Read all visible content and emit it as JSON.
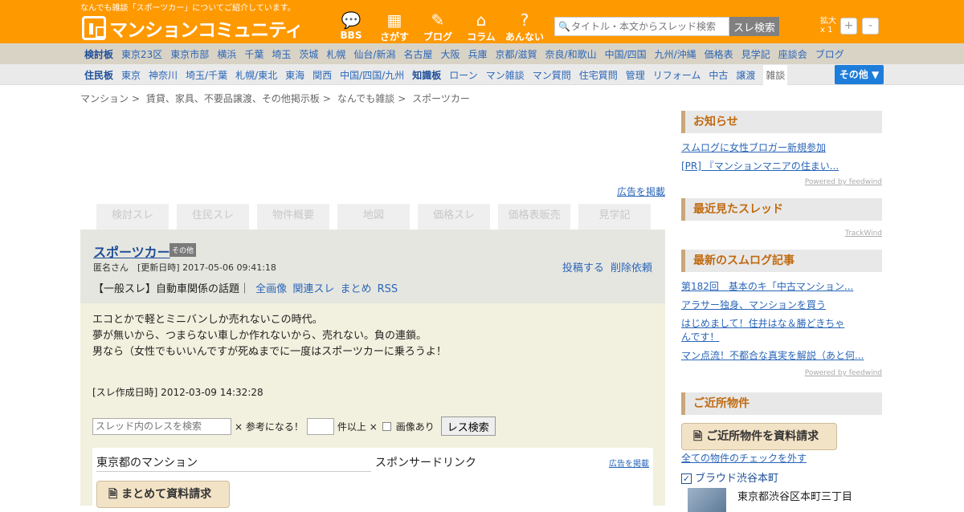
{
  "header": {
    "tagline": "なんでも雑談「スポーツカー」についてご紹介しています。",
    "logo_text": "マンションコミュニティ",
    "nav": [
      {
        "label": "BBS",
        "icon": "speech-bubble-icon"
      },
      {
        "label": "さがす",
        "icon": "buildings-icon"
      },
      {
        "label": "ブログ",
        "icon": "pen-icon"
      },
      {
        "label": "コラム",
        "icon": "house-icon"
      },
      {
        "label": "あんない",
        "icon": "question-icon"
      }
    ],
    "search_placeholder": "タイトル・本文からスレッド検索",
    "search_button": "スレ検索",
    "zoom_label": "拡大",
    "zoom_value": "x 1",
    "zoom_plus": "+",
    "zoom_minus": "-"
  },
  "row1": [
    "検討板",
    "東京23区",
    "東京市部",
    "横浜",
    "千葉",
    "埼玉",
    "茨城",
    "札幌",
    "仙台/新潟",
    "名古屋",
    "大阪",
    "兵庫",
    "京都/滋賀",
    "奈良/和歌山",
    "中国/四国",
    "九州/沖縄",
    "価格表",
    "見学記",
    "座談会",
    "ブログ"
  ],
  "row2": [
    "住民板",
    "東京",
    "神奈川",
    "埼玉/千葉",
    "札幌/東北",
    "東海",
    "関西",
    "中国/四国/九州",
    "知識板",
    "ローン",
    "マン雑談",
    "マン質問",
    "住宅質問",
    "管理",
    "リフォーム",
    "中古",
    "譲渡",
    "雑談"
  ],
  "more_button": "その他 ▼",
  "breadcrumb": [
    "マンション",
    "賃貸、家具、不要品譲渡、その他掲示板",
    "なんでも雑談",
    "スポーツカー"
  ],
  "ad_link": "広告を掲載",
  "property_tabs": [
    "検討スレ",
    "住民スレ",
    "物件概要",
    "地図",
    "価格スレ",
    "価格表販売",
    "見学記"
  ],
  "thread": {
    "title": "スポーツカー",
    "badge": "その他",
    "meta": "匿名さん　[更新日時] 2017-05-06 09:41:18",
    "post": "投稿する",
    "delete": "削除依頼",
    "category": "【一般スレ】自動車関係の話題｜",
    "links": [
      "全画像",
      "関連スレ",
      "まとめ",
      "RSS"
    ],
    "message": [
      "エコとかで軽とミニバンしか売れないこの時代。",
      "夢が無いから、つまらない車しか作れないから、売れない。負の連鎖。",
      "男なら（女性でもいいんですが死ぬまでに一度はスポーツカーに乗ろうよ！"
    ],
    "created": "[スレ作成日時] 2012-03-09 14:32:28"
  },
  "filter": {
    "placeholder": "スレッド内のレスを検索",
    "helpful": "× 参考になる！",
    "count_suffix": "件以上 ×",
    "image": "画像あり",
    "button": "レス検索"
  },
  "inner": {
    "left_title": "東京都のマンション",
    "right_title": "スポンサードリンク",
    "ad": "広告を掲載",
    "request_button": "まとめて資料請求"
  },
  "sidebar": {
    "news_title": "お知らせ",
    "news": [
      "スムログに女性ブロガー新規参加",
      "[PR] 『マンションマニアの住まい..."
    ],
    "powered": "Powered by feedwind",
    "recent_title": "最近見たスレッド",
    "trackwind": "TrackWind",
    "sumlog_title": "最新のスムログ記事",
    "sumlog": [
      "第182回　基本のキ「中古マンション...",
      "アラサー独身、マンションを買う",
      "はじめまして！住井はな＆勝どきちゃんです！",
      "マン点流！不都合な真実を解説（あと何..."
    ],
    "powered2": "Powered by feedwind",
    "nearby_title": "ご近所物件",
    "nearby_button": "ご近所物件を資料請求",
    "uncheck_all": "全ての物件のチェックを外す",
    "property_name": "ブラウド渋谷本町",
    "property_addr": "東京都渋谷区本町三丁目"
  }
}
